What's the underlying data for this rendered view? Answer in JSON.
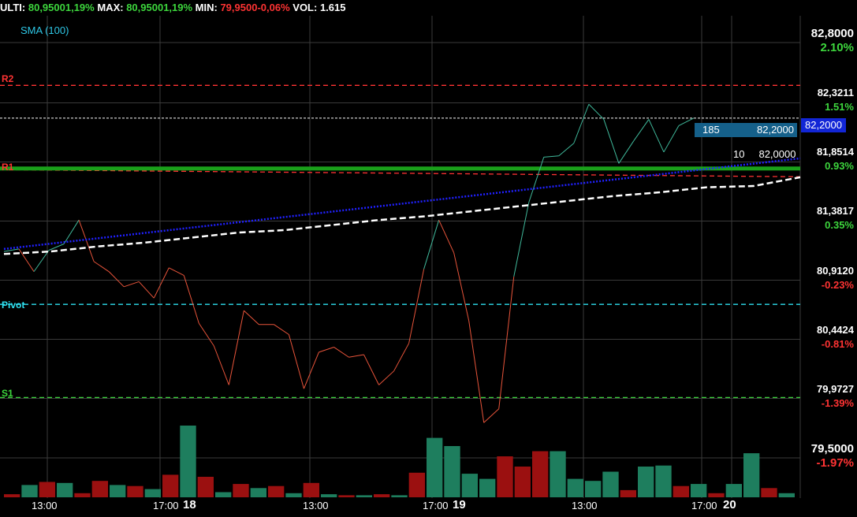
{
  "header": {
    "ulti_label": "ULTI: ",
    "ulti_value": "80,9500",
    "ulti_pct": "1,19%",
    "max_label": " MAX: ",
    "max_value": "80,9500",
    "max_pct": "1,19%",
    "min_label": " MIN: ",
    "min_value": "79,9500",
    "min_pct": "-0,06%",
    "vol_label": " VOL: ",
    "vol_value": "1.615"
  },
  "indicator": {
    "sma_label": "SMA (100)"
  },
  "levels": {
    "r2": "R2",
    "r1": "R1",
    "pivot": "Pivot",
    "s1": "S1"
  },
  "order_tags": {
    "last_price": "82,2000",
    "bid_qty": "185",
    "bid_price": "82,2000",
    "ask_qty": "10",
    "ask_price": "82,0000"
  },
  "colors": {
    "up": "#3dd63d",
    "down": "#ff3333",
    "r_level": "#ff3333",
    "pivot": "#2ee0f0",
    "s_level": "#3dd63d",
    "line_up": "#3fb89a",
    "line_down": "#e8543a",
    "sma": "#ffffff",
    "trend": "#2020ff",
    "vol_up": "#1e7e5e",
    "vol_down": "#9b1010",
    "grid": "#3a3a3a"
  },
  "chart_data": {
    "type": "line",
    "ylim": [
      79.5,
      82.8
    ],
    "y_ticks": [
      {
        "price": "82,8000",
        "pct": "2.10%",
        "value": 82.8
      },
      {
        "price": "82,3211",
        "pct": "1.51%",
        "value": 82.3211
      },
      {
        "price": "81,8514",
        "pct": "0.93%",
        "value": 81.8514
      },
      {
        "price": "81,3817",
        "pct": "0.35%",
        "value": 81.3817
      },
      {
        "price": "80,9120",
        "pct": "-0.23%",
        "value": 80.912
      },
      {
        "price": "80,4424",
        "pct": "-0.81%",
        "value": 80.4424
      },
      {
        "price": "79,9727",
        "pct": "-1.39%",
        "value": 79.9727
      },
      {
        "price": "79,5000",
        "pct": "-1.97%",
        "value": 79.5
      }
    ],
    "x_ticks": [
      "13:00",
      "17:00",
      "18",
      "13:00",
      "17:00",
      "19",
      "13:00",
      "17:00",
      "20"
    ],
    "levels": {
      "R2": 82.46,
      "R1": 81.79,
      "Pivot": 80.72,
      "S1": 79.98,
      "last": 82.2
    },
    "price_series": [
      81.14,
      81.16,
      80.98,
      81.15,
      81.2,
      81.39,
      81.06,
      80.98,
      80.86,
      80.9,
      80.77,
      81.01,
      80.95,
      80.57,
      80.39,
      80.08,
      80.67,
      80.56,
      80.56,
      80.48,
      80.05,
      80.34,
      80.38,
      80.3,
      80.32,
      80.08,
      80.19,
      80.41,
      81.0,
      81.39,
      81.13,
      80.59,
      79.78,
      79.89,
      80.94,
      81.53,
      81.89,
      81.9,
      82.0,
      82.31,
      82.19,
      81.84,
      82.02,
      82.19,
      81.93,
      82.14,
      82.2
    ],
    "sma_series": [
      81.12,
      81.14,
      81.18,
      81.21,
      81.25,
      81.29,
      81.31,
      81.35,
      81.39,
      81.42,
      81.46,
      81.5,
      81.54,
      81.58,
      81.61,
      81.65,
      81.66,
      81.73
    ],
    "trend_series": [
      81.16,
      81.88
    ],
    "volume": [
      {
        "v": 3,
        "up": false
      },
      {
        "v": 12,
        "up": true
      },
      {
        "v": 15,
        "up": false
      },
      {
        "v": 14,
        "up": true
      },
      {
        "v": 4,
        "up": false
      },
      {
        "v": 16,
        "up": false
      },
      {
        "v": 12,
        "up": true
      },
      {
        "v": 11,
        "up": false
      },
      {
        "v": 8,
        "up": true
      },
      {
        "v": 22,
        "up": false
      },
      {
        "v": 70,
        "up": true
      },
      {
        "v": 20,
        "up": false
      },
      {
        "v": 5,
        "up": true
      },
      {
        "v": 13,
        "up": false
      },
      {
        "v": 9,
        "up": true
      },
      {
        "v": 11,
        "up": false
      },
      {
        "v": 4,
        "up": true
      },
      {
        "v": 14,
        "up": false
      },
      {
        "v": 3,
        "up": true
      },
      {
        "v": 2,
        "up": false
      },
      {
        "v": 2,
        "up": true
      },
      {
        "v": 3,
        "up": false
      },
      {
        "v": 2,
        "up": true
      },
      {
        "v": 24,
        "up": false
      },
      {
        "v": 58,
        "up": true
      },
      {
        "v": 50,
        "up": true
      },
      {
        "v": 23,
        "up": true
      },
      {
        "v": 18,
        "up": true
      },
      {
        "v": 40,
        "up": false
      },
      {
        "v": 30,
        "up": false
      },
      {
        "v": 45,
        "up": false
      },
      {
        "v": 45,
        "up": true
      },
      {
        "v": 18,
        "up": true
      },
      {
        "v": 16,
        "up": true
      },
      {
        "v": 25,
        "up": true
      },
      {
        "v": 7,
        "up": false
      },
      {
        "v": 30,
        "up": true
      },
      {
        "v": 31,
        "up": true
      },
      {
        "v": 11,
        "up": false
      },
      {
        "v": 13,
        "up": true
      },
      {
        "v": 4,
        "up": false
      },
      {
        "v": 13,
        "up": true
      },
      {
        "v": 43,
        "up": true
      },
      {
        "v": 9,
        "up": false
      },
      {
        "v": 4,
        "up": true
      }
    ]
  }
}
